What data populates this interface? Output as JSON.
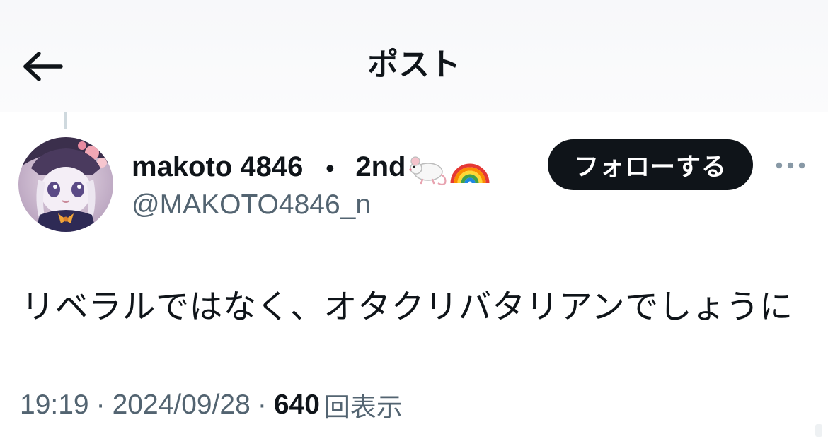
{
  "header": {
    "title": "ポスト",
    "back_icon": "arrow-left-icon"
  },
  "author": {
    "display_name": "makoto 4846",
    "separator": "・",
    "degree": "2nd",
    "emojis": [
      "mouse-emoji",
      "rainbow-emoji"
    ],
    "handle": "@MAKOTO4846_n",
    "follow_label": "フォローする",
    "more_icon": "more-horizontal-icon"
  },
  "post": {
    "text": "リベラルではなく、オタクリバタリアンでしょうに"
  },
  "meta": {
    "time": "19:19",
    "sep1": "·",
    "date": "2024/09/28",
    "sep2": "·",
    "views_count": "640",
    "views_label": "回表示"
  },
  "colors": {
    "text_primary": "#0f1419",
    "text_secondary": "#536471",
    "follow_bg": "#0f1419",
    "thread_line": "#cfd9de"
  }
}
